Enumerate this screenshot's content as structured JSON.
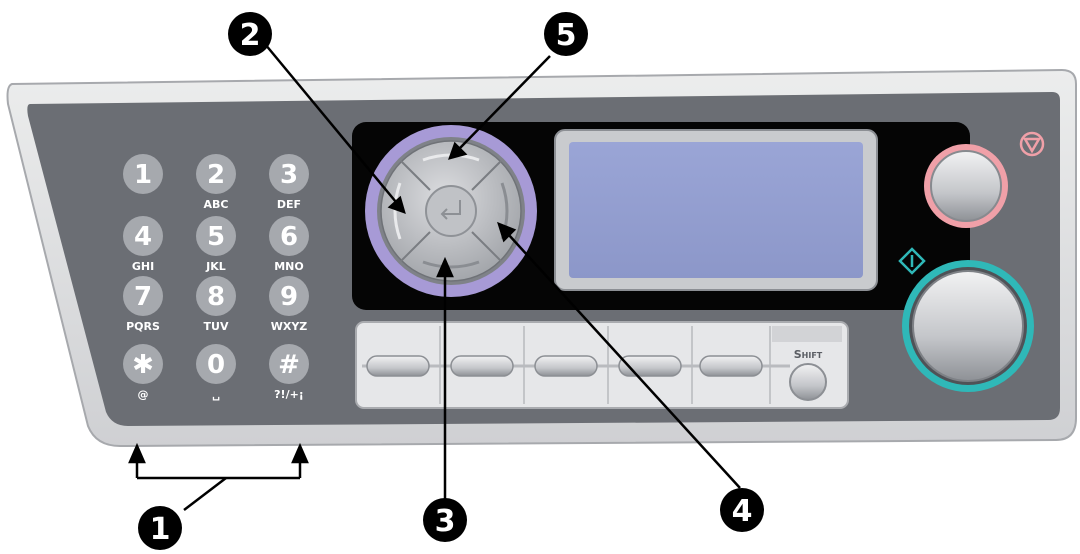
{
  "keypad": {
    "keys": [
      {
        "digit": "1",
        "sub": ""
      },
      {
        "digit": "2",
        "sub": "ABC"
      },
      {
        "digit": "3",
        "sub": "DEF"
      },
      {
        "digit": "4",
        "sub": "GHI"
      },
      {
        "digit": "5",
        "sub": "JKL"
      },
      {
        "digit": "6",
        "sub": "MNO"
      },
      {
        "digit": "7",
        "sub": "PQRS"
      },
      {
        "digit": "8",
        "sub": "TUV"
      },
      {
        "digit": "9",
        "sub": "WXYZ"
      },
      {
        "digit": "*",
        "sub": "@"
      },
      {
        "digit": "0",
        "sub": "␣"
      },
      {
        "digit": "#",
        "sub": "?!/+¡"
      }
    ]
  },
  "shift_label": "Shift",
  "callouts": [
    "1",
    "2",
    "3",
    "4",
    "5"
  ],
  "colors": {
    "panel": "#6b6e74",
    "bezel": "#d9dadc",
    "key": "#a6a9ae",
    "display": "#97a2d2",
    "nav_ring": "#a79ad6",
    "stop_ring": "#f0a0a8",
    "start_ring": "#2fb8b8"
  },
  "icons": [
    "stop-icon",
    "start-icon",
    "enter-icon"
  ]
}
